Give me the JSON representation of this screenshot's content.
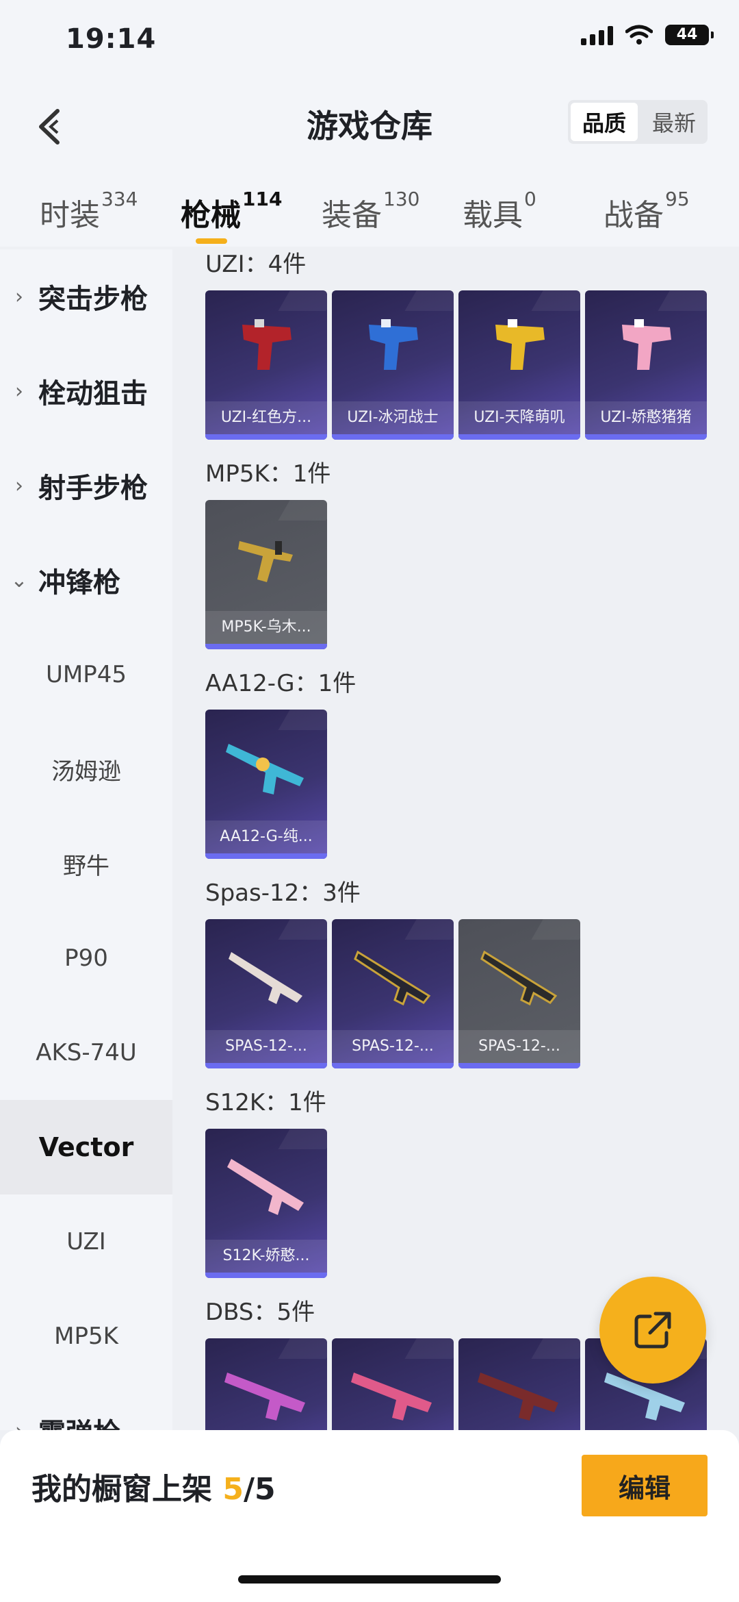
{
  "status": {
    "time": "19:14",
    "battery": "44"
  },
  "header": {
    "title": "游戏仓库",
    "sort": [
      "品质",
      "最新"
    ],
    "tabs": [
      {
        "label": "时装",
        "count": "334"
      },
      {
        "label": "枪械",
        "count": "114"
      },
      {
        "label": "装备",
        "count": "130"
      },
      {
        "label": "载具",
        "count": "0"
      },
      {
        "label": "战备",
        "count": "95"
      }
    ]
  },
  "sidebar": {
    "categories": [
      "突击步枪",
      "栓动狙击",
      "射手步枪",
      "冲锋枪",
      "霰弹枪"
    ],
    "subs": [
      "UMP45",
      "汤姆逊",
      "野牛",
      "P90",
      "AKS-74U",
      "Vector",
      "UZI",
      "MP5K"
    ]
  },
  "groups": [
    {
      "title": "UZI：4件",
      "items": [
        "UZI-红色方...",
        "UZI-冰河战士",
        "UZI-天降萌叽",
        "UZI-娇憨猪猪"
      ]
    },
    {
      "title": "MP5K：1件",
      "items": [
        "MP5K-乌木..."
      ]
    },
    {
      "title": "AA12-G：1件",
      "items": [
        "AA12-G-纯..."
      ]
    },
    {
      "title": "Spas-12：3件",
      "items": [
        "SPAS-12-...",
        "SPAS-12-...",
        "SPAS-12-..."
      ]
    },
    {
      "title": "S12K：1件",
      "items": [
        "S12K-娇憨..."
      ]
    },
    {
      "title": "DBS：5件",
      "items": []
    }
  ],
  "bottom": {
    "shelf_text": "我的橱窗上架",
    "shelf_current": "5",
    "shelf_total": "/5",
    "edit": "编辑"
  },
  "colors": {
    "accent": "#f5b01c",
    "card_purple": "#3b3470",
    "card_grey": "#55575e",
    "rare_bar": "#6b6cf0"
  }
}
